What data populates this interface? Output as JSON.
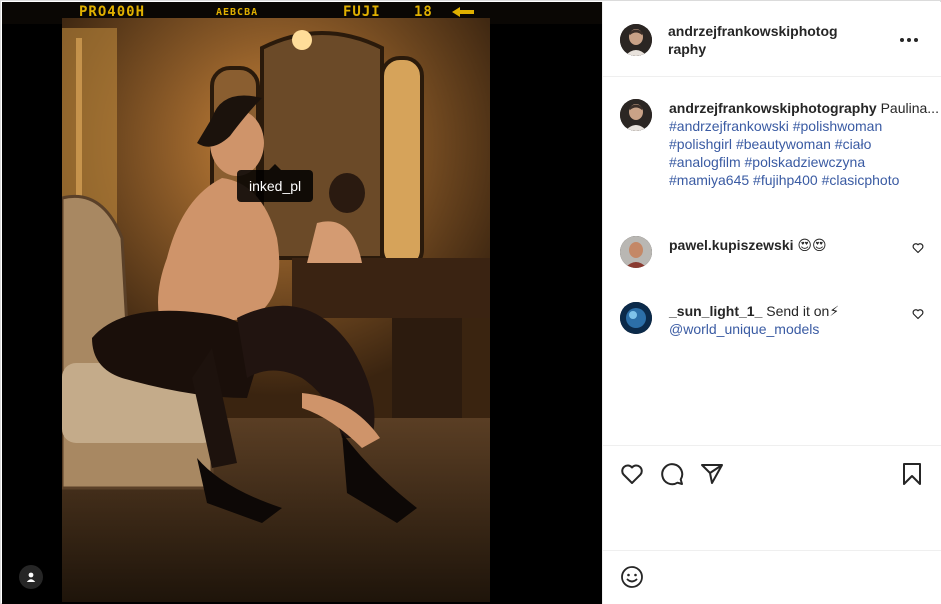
{
  "film": {
    "code_left": "PRO400H",
    "code_mid": "AEBCBA",
    "brand": "FUJI",
    "frame_number": "18",
    "color": "#e0b000"
  },
  "photo": {
    "tag_username": "inked_pl"
  },
  "post": {
    "author": "andrzejfrankowskiphotography",
    "author_line1": "andrzejfrankowskiphotog",
    "author_line2": "raphy",
    "caption_user": "andrzejfrankowskiphotography",
    "caption_text": "Paulina...",
    "hashtags": [
      "#andrzejfrankowski",
      "#polishwoman",
      "#polishgirl",
      "#beautywoman",
      "#ciało",
      "#analogfilm",
      "#polskadziewczyna",
      "#mamiya645",
      "#fujihp400",
      "#clasicphoto"
    ],
    "link_color": "#3a5ba3"
  },
  "comments": [
    {
      "user": "pawel.kupiszewski",
      "text": "😍😍"
    },
    {
      "user": "_sun_light_1_",
      "text": "Send it on⚡",
      "mention": "@world_unique_models"
    }
  ],
  "icons": {
    "more": "more-horizontal-icon",
    "like": "heart-icon",
    "comment": "comment-bubble-icon",
    "share": "paper-plane-icon",
    "save": "bookmark-icon",
    "emoji": "smiley-icon",
    "tags": "user-tag-icon"
  }
}
